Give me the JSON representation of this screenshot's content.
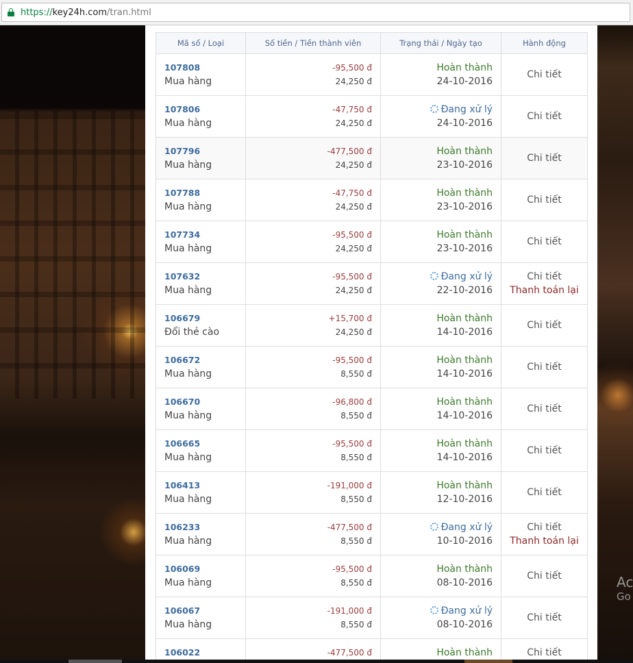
{
  "browser": {
    "url_scheme": "https://",
    "url_host": "key24h.com",
    "url_path": "/tran.html"
  },
  "watermark": {
    "line1": "Ac",
    "line2": "Go"
  },
  "table": {
    "headers": {
      "id_type": "Mã số / Loại",
      "amount": "Số tiền / Tiền thành viên",
      "status": "Trạng thái / Ngày tạo",
      "action": "Hành động"
    },
    "rows": [
      {
        "id": "107808",
        "type": "Mua hàng",
        "amount": "-95,500 đ",
        "member": "24,250 đ",
        "status": "Hoàn thành",
        "status_kind": "done",
        "date": "24-10-2016",
        "detail": "Chi tiết",
        "repay": ""
      },
      {
        "id": "107806",
        "type": "Mua hàng",
        "amount": "-47,750 đ",
        "member": "24,250 đ",
        "status": "Đang xử lý",
        "status_kind": "pending",
        "date": "24-10-2016",
        "detail": "Chi tiết",
        "repay": ""
      },
      {
        "id": "107796",
        "type": "Mua hàng",
        "amount": "-477,500 đ",
        "member": "24,250 đ",
        "status": "Hoàn thành",
        "status_kind": "done",
        "date": "23-10-2016",
        "detail": "Chi tiết",
        "repay": ""
      },
      {
        "id": "107788",
        "type": "Mua hàng",
        "amount": "-47,750 đ",
        "member": "24,250 đ",
        "status": "Hoàn thành",
        "status_kind": "done",
        "date": "23-10-2016",
        "detail": "Chi tiết",
        "repay": ""
      },
      {
        "id": "107734",
        "type": "Mua hàng",
        "amount": "-95,500 đ",
        "member": "24,250 đ",
        "status": "Hoàn thành",
        "status_kind": "done",
        "date": "23-10-2016",
        "detail": "Chi tiết",
        "repay": ""
      },
      {
        "id": "107632",
        "type": "Mua hàng",
        "amount": "-95,500 đ",
        "member": "24,250 đ",
        "status": "Đang xử lý",
        "status_kind": "pending",
        "date": "22-10-2016",
        "detail": "Chi tiết",
        "repay": "Thanh toán lại"
      },
      {
        "id": "106679",
        "type": "Đổi thẻ cào",
        "amount": "+15,700 đ",
        "member": "24,250 đ",
        "status": "Hoàn thành",
        "status_kind": "done",
        "date": "14-10-2016",
        "detail": "Chi tiết",
        "repay": ""
      },
      {
        "id": "106672",
        "type": "Mua hàng",
        "amount": "-95,500 đ",
        "member": "8,550 đ",
        "status": "Hoàn thành",
        "status_kind": "done",
        "date": "14-10-2016",
        "detail": "Chi tiết",
        "repay": ""
      },
      {
        "id": "106670",
        "type": "Mua hàng",
        "amount": "-96,800 đ",
        "member": "8,550 đ",
        "status": "Hoàn thành",
        "status_kind": "done",
        "date": "14-10-2016",
        "detail": "Chi tiết",
        "repay": ""
      },
      {
        "id": "106665",
        "type": "Mua hàng",
        "amount": "-95,500 đ",
        "member": "8,550 đ",
        "status": "Hoàn thành",
        "status_kind": "done",
        "date": "14-10-2016",
        "detail": "Chi tiết",
        "repay": ""
      },
      {
        "id": "106413",
        "type": "Mua hàng",
        "amount": "-191,000 đ",
        "member": "8,550 đ",
        "status": "Hoàn thành",
        "status_kind": "done",
        "date": "12-10-2016",
        "detail": "Chi tiết",
        "repay": ""
      },
      {
        "id": "106233",
        "type": "Mua hàng",
        "amount": "-477,500 đ",
        "member": "8,550 đ",
        "status": "Đang xử lý",
        "status_kind": "pending",
        "date": "10-10-2016",
        "detail": "Chi tiết",
        "repay": "Thanh toán lại"
      },
      {
        "id": "106069",
        "type": "Mua hàng",
        "amount": "-95,500 đ",
        "member": "8,550 đ",
        "status": "Hoàn thành",
        "status_kind": "done",
        "date": "08-10-2016",
        "detail": "Chi tiết",
        "repay": ""
      },
      {
        "id": "106067",
        "type": "Mua hàng",
        "amount": "-191,000 đ",
        "member": "8,550 đ",
        "status": "Đang xử lý",
        "status_kind": "pending",
        "date": "08-10-2016",
        "detail": "Chi tiết",
        "repay": ""
      },
      {
        "id": "106022",
        "type": "",
        "amount": "-477,500 đ",
        "member": "",
        "status": "Hoàn thành",
        "status_kind": "done",
        "date": "",
        "detail": "Chi tiết",
        "repay": ""
      }
    ]
  }
}
